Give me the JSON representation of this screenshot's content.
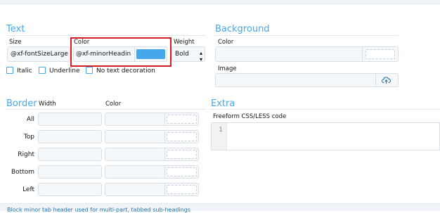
{
  "text_section": {
    "title": "Text",
    "size_label": "Size",
    "size_value": "@xf-fontSizeLarge",
    "color_label": "Color",
    "color_value": "@xf-minorHeadin",
    "color_swatch": "#47a7eb",
    "weight_label": "Weight",
    "weight_value": "Bold",
    "options": [
      {
        "label": "Italic",
        "checked": false
      },
      {
        "label": "Underline",
        "checked": false
      },
      {
        "label": "No text decoration",
        "checked": false
      }
    ]
  },
  "background_section": {
    "title": "Background",
    "color_label": "Color",
    "color_value": "",
    "image_label": "Image",
    "image_value": ""
  },
  "border_section": {
    "title": "Border",
    "width_label": "Width",
    "color_label": "Color",
    "rows": [
      "All",
      "Top",
      "Right",
      "Bottom",
      "Left"
    ]
  },
  "extra_section": {
    "title": "Extra",
    "code_label": "Freeform CSS/LESS code",
    "line_number": "1"
  },
  "footer": {
    "description": "Block minor tab header used for multi-part, tabbed sub-headings"
  },
  "colors": {
    "accent": "#47a7eb",
    "highlight": "#d11d24"
  }
}
